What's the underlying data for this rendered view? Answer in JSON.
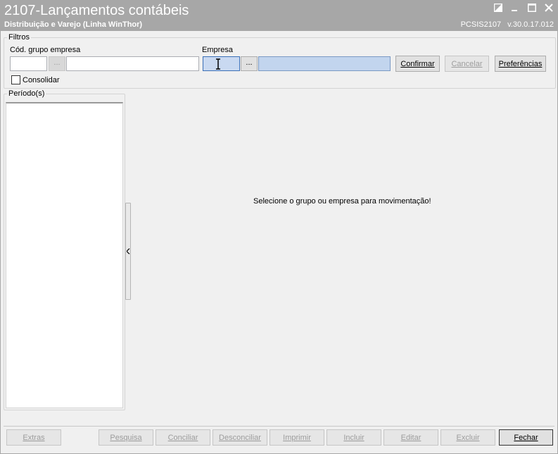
{
  "window": {
    "title": "2107-Lançamentos contábeis",
    "subtitle": "Distribuição e Varejo (Linha WinThor)",
    "code": "PCSIS2107",
    "version": "v.30.0.17.012",
    "controls": [
      "restore-icon",
      "minimize-icon",
      "maximize-icon",
      "close-icon"
    ]
  },
  "filters": {
    "legend": "Filtros",
    "grupo_label": "Cód. grupo empresa",
    "grupo_code_value": "",
    "grupo_dots": "...",
    "grupo_name_value": "",
    "empresa_label": "Empresa",
    "empresa_code_value": "",
    "empresa_dots": "...",
    "empresa_name_value": "",
    "consolidar_label": "Consolidar",
    "consolidar_checked": false,
    "buttons": {
      "confirmar": "Confirmar",
      "cancelar": "Cancelar",
      "preferencias": "Preferências"
    }
  },
  "periodos": {
    "legend": "Período(s)",
    "items": []
  },
  "main": {
    "message": "Selecione o grupo ou empresa para movimentação!"
  },
  "footer": {
    "buttons": {
      "extras": "Extras",
      "pesquisa": "Pesquisa",
      "conciliar": "Conciliar",
      "desconciliar": "Desconciliar",
      "imprimir": "Imprimir",
      "incluir": "Incluir",
      "editar": "Editar",
      "excluir": "Excluir",
      "fechar": "Fechar"
    }
  },
  "colors": {
    "titlebar": "#a7a7a7",
    "active_input": "#c9d9f1",
    "disabled_text": "#9c9c9c"
  }
}
